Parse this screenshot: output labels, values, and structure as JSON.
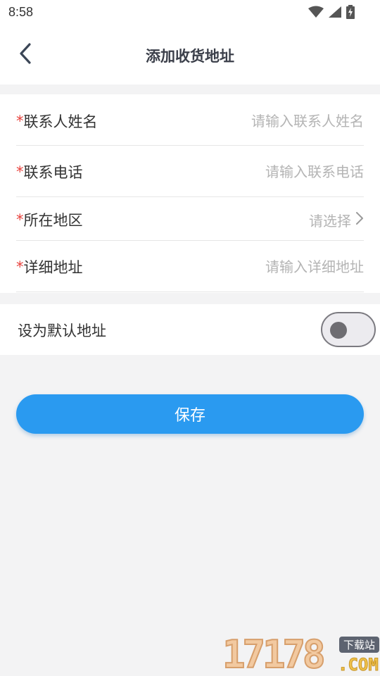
{
  "status_bar": {
    "time": "8:58",
    "icons": [
      "wifi-icon",
      "cellular-signal-icon",
      "battery-charging-icon"
    ]
  },
  "nav": {
    "title": "添加收货地址",
    "back_icon": "chevron-left-icon"
  },
  "form": {
    "required_mark": "*",
    "fields": [
      {
        "label": "联系人姓名",
        "placeholder": "请输入联系人姓名",
        "value": ""
      },
      {
        "label": "联系电话",
        "placeholder": "请输入联系电话",
        "value": ""
      },
      {
        "label": "所在地区",
        "select_text": "请选择",
        "icon": "chevron-right-icon"
      },
      {
        "label": "详细地址",
        "placeholder": "请输入详细地址",
        "value": ""
      }
    ]
  },
  "default_address": {
    "label": "设为默认地址",
    "enabled": false
  },
  "save_button": {
    "label": "保存"
  },
  "watermark": {
    "number": "17178",
    "badge": "下载站",
    "domain": ".COM"
  },
  "colors": {
    "accent": "#2a9af0",
    "required": "#e8413c",
    "placeholder": "#b4b4b4",
    "background": "#f3f3f4"
  }
}
